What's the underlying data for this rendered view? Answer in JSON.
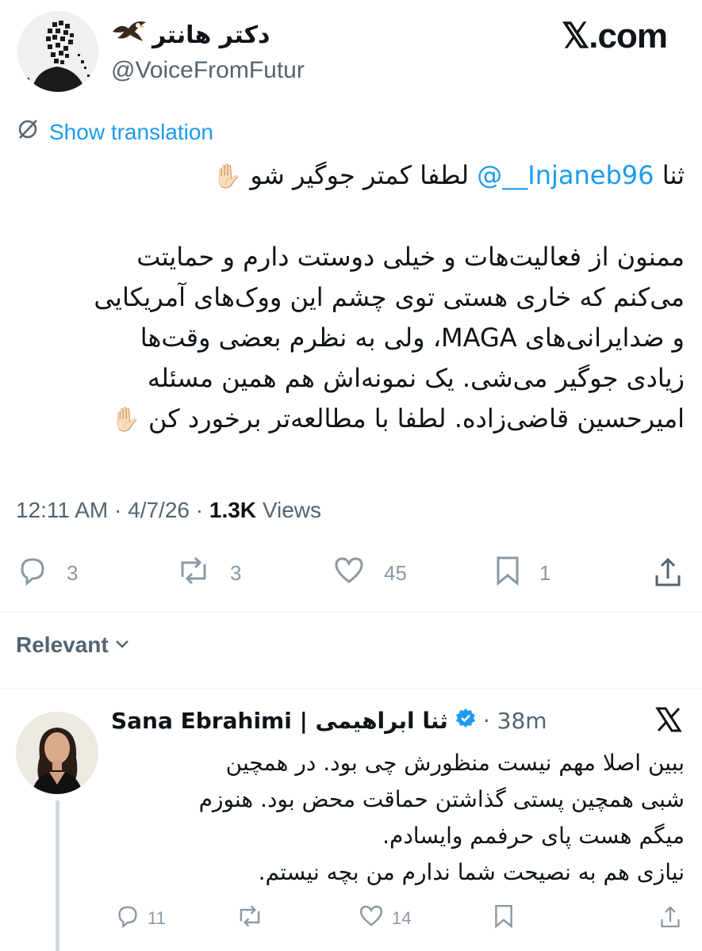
{
  "tweet": {
    "author_name": "دکتر هانتر",
    "author_handle": "@VoiceFromFutur",
    "site": "𝕏.com",
    "translate_label": "Show translation",
    "line1_prefix": "ثنا ",
    "line1_mention": "@__Injaneb96",
    "line1_suffix": " لطفا کمتر جوگیر شو ",
    "hand_emoji": "✋🏻",
    "body_lines": [
      "ممنون از فعالیت‌هات و خیلی دوستت دارم و حمایتت",
      "می‌کنم که خاری هستی توی چشم این ووک‌های آمریکایی",
      "و ضدایرانی‌های MAGA، ولی به نظرم بعضی وقت‌ها",
      "زیادی جوگیر می‌شی. یک نمونه‌اش هم همین مسئله"
    ],
    "body_last_line": "امیرحسین قاضی‌زاده. لطفا با مطالعه‌تر برخورد کن ",
    "time": "12:11 AM",
    "date": "4/7/26",
    "views_count": "1.3K",
    "views_label": "Views",
    "replies": "3",
    "reposts": "3",
    "likes": "45",
    "bookmarks": "1"
  },
  "sort_label": "Relevant",
  "reply": {
    "name": "Sana Ebrahimi | ثنا ابراهیمی",
    "time": "38m",
    "lines": [
      "ببین اصلا مهم نیست منظورش چی بود. در همچین",
      "شبی همچین پستی گذاشتن حماقت محض بود. هنوزم",
      "میگم هست پای حرفمم وایسادم.",
      "نیازی هم به نصیحت شما ندارم من بچه نیستم."
    ],
    "replies": "11",
    "likes": "14"
  },
  "colors": {
    "link": "#1d9bf0",
    "secondary_text": "#536471",
    "icon": "#8b98a5",
    "divider": "#eff3f4",
    "verified": "#1d9bf0"
  },
  "icons": [
    "eagle-emoji",
    "translate-icon",
    "reply-icon",
    "repost-icon",
    "like-icon",
    "bookmark-icon",
    "share-icon",
    "chevron-down-icon",
    "verified-badge-icon",
    "x-logo-icon"
  ]
}
